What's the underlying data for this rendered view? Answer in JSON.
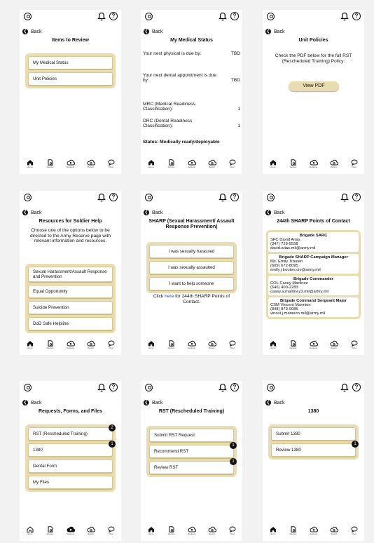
{
  "common": {
    "back_label": "Back",
    "help_glyph": "?",
    "avatar_icon": "person-circle-icon",
    "bell_icon": "bell-icon",
    "help_icon": "help-circle-icon",
    "accent_color": "#e8dcb0",
    "nav": [
      {
        "label": "Home",
        "icon": "home-icon"
      },
      {
        "label": "Review",
        "icon": "document-search-icon"
      },
      {
        "label": "Request",
        "icon": "cloud-upload-icon"
      },
      {
        "label": "Report",
        "icon": "cloud-report-icon"
      },
      {
        "label": "Chat",
        "icon": "chat-bubble-icon"
      }
    ]
  },
  "items_to_review": {
    "title": "Items to Review",
    "items": [
      "My Medical Status",
      "Unit Policies"
    ]
  },
  "medical_status": {
    "title": "My Medical Status",
    "physical_label": "Your next physical is due by:",
    "physical_value": "TBD",
    "dental_label": "Your next dental appointment is due by:",
    "dental_value": "TBD",
    "mrc_label": "MRC (Medical Readiness Classification):",
    "mrc_value": "1",
    "drc_label": "DRC (Dental Readiness Classification):",
    "drc_value": "1",
    "status": "Status: Medically ready/deployable"
  },
  "unit_policies": {
    "title": "Unit Policies",
    "text": "Check the PDF below for the full RST (Rescheduled Training) Policy:",
    "button": "View PDF"
  },
  "resources": {
    "title": "Resources for Soldier Help",
    "text": "Choose one of the options below to be directed to the Army Reserve page with relevant information and resources.",
    "items": [
      "Sexual Harassment/Assault Response and Prevention",
      "Equal Opportunity",
      "Suicide Prevention",
      "DoD Safe Helpline"
    ]
  },
  "sharp": {
    "title": "SHARP (Sexual Harassment/ Assault Response Prevention)",
    "items": [
      "I was sexually harassed",
      "I was sexually assaulted",
      "I want to help someone"
    ],
    "click_prefix": "Click ",
    "click_link": "here",
    "click_suffix": " for 244th SHARP Points of Contact."
  },
  "contacts": {
    "title": "244th SHARP Points of Contact",
    "entries": [
      {
        "heading": "Brigade SARC",
        "lines": [
          "SFC David Arias",
          "(347) 729-5558",
          "david.arias.mil@army.mil"
        ]
      },
      {
        "heading": "Brigade SHARP Campaign Manager",
        "lines": [
          "Ms. Emily Trouten",
          "(609) 672-8095",
          "emily.j.trouten.civ@army.mil"
        ]
      },
      {
        "heading": "Brigade Commander",
        "lines": [
          "COL Casey Martinez",
          "(646) 400-2283",
          "casey.a.martinez3.mil@army.mil"
        ]
      },
      {
        "heading": "Brigade Command Sergeant Major",
        "lines": [
          "CSM Vincent Mannion",
          "(848) 879-9085",
          "vincet.j.mannion.mil@army.mil"
        ]
      }
    ]
  },
  "requests": {
    "title": "Requests, Forms, and Files",
    "items": [
      {
        "label": "RST (Rescheduled Training)",
        "badge": "2"
      },
      {
        "label": "1380",
        "badge": "1"
      },
      {
        "label": "Dental Form",
        "badge": ""
      },
      {
        "label": "My Files",
        "badge": ""
      }
    ]
  },
  "rst": {
    "title": "RST (Rescheduled Training)",
    "items": [
      {
        "label": "Submit RST Request",
        "badge": ""
      },
      {
        "label": "Recommend RST",
        "badge": "1"
      },
      {
        "label": "Review RST",
        "badge": "1"
      }
    ]
  },
  "form1380": {
    "title": "1380",
    "items": [
      {
        "label": "Submit 1380",
        "badge": ""
      },
      {
        "label": "Review 1380",
        "badge": "1"
      }
    ]
  }
}
